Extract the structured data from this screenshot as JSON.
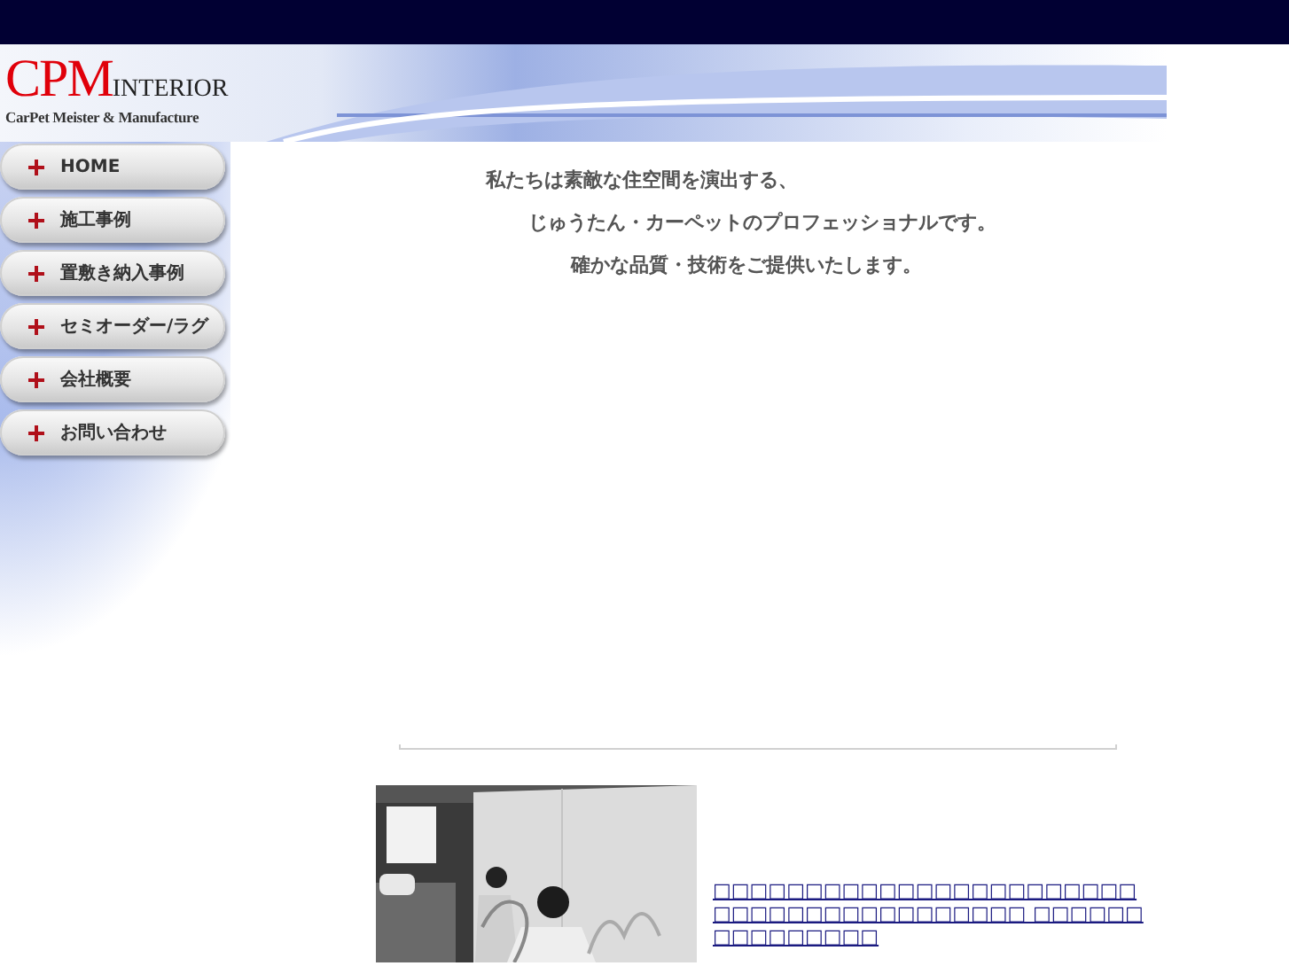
{
  "logo": {
    "mark": "CPM",
    "word": "INTERIOR",
    "tagline": "CarPet Meister & Manufacture"
  },
  "nav": [
    {
      "label": "HOME"
    },
    {
      "label": "施工事例"
    },
    {
      "label": "置敷き納入事例"
    },
    {
      "label": "セミオーダー/ラグ"
    },
    {
      "label": "会社概要"
    },
    {
      "label": "お問い合わせ"
    }
  ],
  "intro": [
    "私たちは素敵な住空間を演出する、",
    "じゅうたん・カーペットのプロフェッショナルです。",
    "確かな品質・技術をご提供いたします。"
  ],
  "news": {
    "text": "□□□□□□□□□□□□□□□□□□□□□□□□□□□□□□□□□□□□□□□□ □□□□□□□□□□□□□□□"
  }
}
